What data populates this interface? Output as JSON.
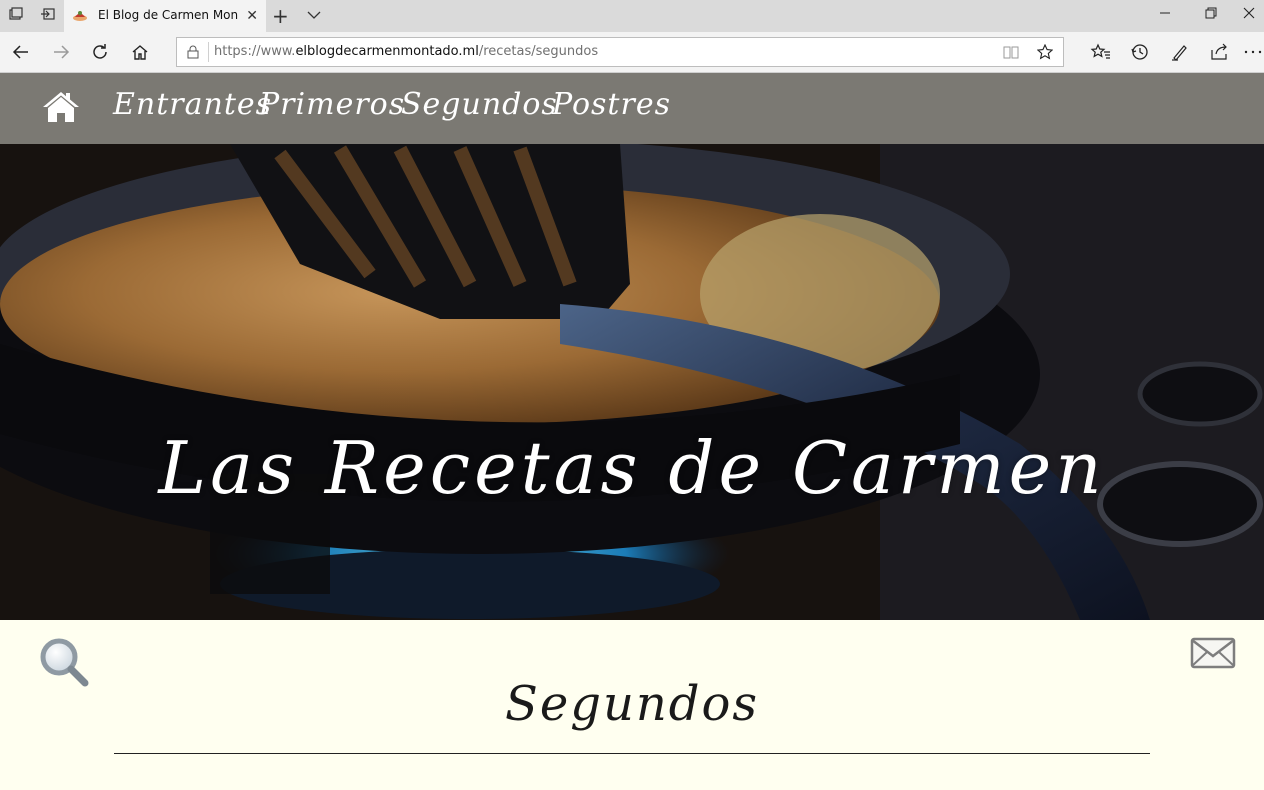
{
  "browser": {
    "tab_title": "El Blog de Carmen Mon",
    "address": {
      "prefix": "https://www.",
      "domain": "elblogdecarmenmontado.ml",
      "path": "/recetas/segundos"
    }
  },
  "site": {
    "nav_items": [
      "Entrantes",
      "Primeros",
      "Segundos",
      "Postres"
    ],
    "hero_title": "Las Recetas de Carmen",
    "section_title": "Segundos"
  },
  "colors": {
    "nav_bar": "#7b7973",
    "page_bg": "#fffff0",
    "hero_text": "#ffffff"
  },
  "icons": {
    "home": "home-icon",
    "search": "search-icon",
    "mail": "mail-icon"
  }
}
